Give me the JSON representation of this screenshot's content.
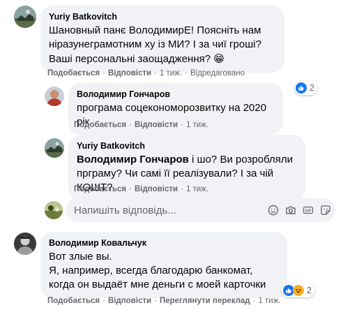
{
  "comments": [
    {
      "author": "Yuriy Batkovitch",
      "text": "Шановный панє ВолодимирЕ! Поясніть нам ніразунеграмотним ху із МИ? І за чиї гроші? Ваші персональні заощадження?",
      "emoji": "😁",
      "actions": {
        "like": "Подобається",
        "reply": "Відповісти",
        "time": "1 тиж.",
        "edited": "Відредаговано"
      },
      "reactions": {
        "count": "2"
      }
    },
    {
      "author": "Володимир Гончаров",
      "text": "програма соцекономорозвитку на 2020 рік",
      "actions": {
        "like": "Подобається",
        "reply": "Відповісти",
        "time": "1 тиж."
      }
    },
    {
      "author": "Yuriy Batkovitch",
      "mention": "Володимир Гончаров",
      "text": " і шо? Ви розробляли прграму? Чи самі її реалізували? І за чій КОШТ?",
      "actions": {
        "like": "Подобається",
        "reply": "Відповісти",
        "time": "1 тиж."
      }
    },
    {
      "author": "Володимир Ковальчук",
      "text1": "Вот злые вы.",
      "text2": "Я, например, всегда благодарю банкомат, когда он выдаёт мне деньги с моей карточки",
      "actions": {
        "like": "Подобається",
        "reply": "Відповісти",
        "translate": "Переглянути переклад",
        "time": "1 тиж."
      },
      "reactions": {
        "count": "2"
      }
    }
  ],
  "compose": {
    "placeholder": "Напишіть відповідь..."
  },
  "colors": {
    "like_blue": "#1877f2",
    "haha_yellow": "#f7b125",
    "bubble": "#f0f2f5",
    "meta": "#65676b"
  }
}
